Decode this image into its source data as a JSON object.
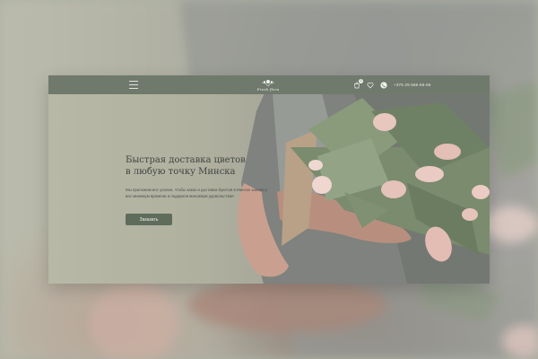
{
  "header": {
    "logo_text": "Fresh flora",
    "cart_count": "2",
    "phone": "+375 29 666-66-66"
  },
  "hero": {
    "title_line1": "Быстрая доставка цветов",
    "title_line2": "в любую точку Минска",
    "text": "Мы приложим все усилия, чтобы заказ и доставка букетов в Минске заняли у вас минимум времени и подарили максимум удовольствия",
    "cta_label": "Заказать"
  },
  "icons": {
    "menu": "menu-icon",
    "cart": "cart-icon",
    "favorites": "heart-icon",
    "phone": "phone-icon",
    "logo": "flower-logo"
  },
  "colors": {
    "header_bg": "#6f7a6c",
    "button_bg": "#5f6c5c",
    "title_text": "#3f4541"
  }
}
